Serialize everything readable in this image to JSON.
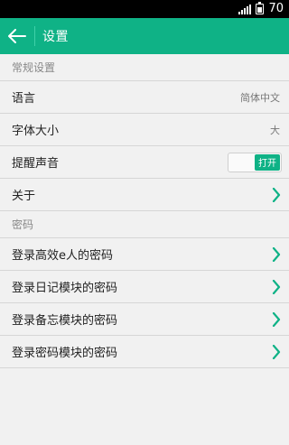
{
  "status_bar": {
    "battery_text": "70",
    "signal_icon": "signal-icon",
    "battery_icon": "battery-icon"
  },
  "app_bar": {
    "back_icon": "arrow-left-icon",
    "title": "设置",
    "color": "#0fb286"
  },
  "sections": {
    "general": {
      "header": "常规设置",
      "language_label": "语言",
      "language_value": "简体中文",
      "font_size_label": "字体大小",
      "font_size_value": "大",
      "reminder_sound_label": "提醒声音",
      "reminder_sound_toggle": "打开",
      "about_label": "关于"
    },
    "password": {
      "header": "密码",
      "items": [
        "登录高效e人的密码",
        "登录日记模块的密码",
        "登录备忘模块的密码",
        "登录密码模块的密码"
      ]
    }
  },
  "colors": {
    "accent": "#0fb286",
    "background": "#f1f1f1",
    "divider": "#d6d6d6"
  }
}
